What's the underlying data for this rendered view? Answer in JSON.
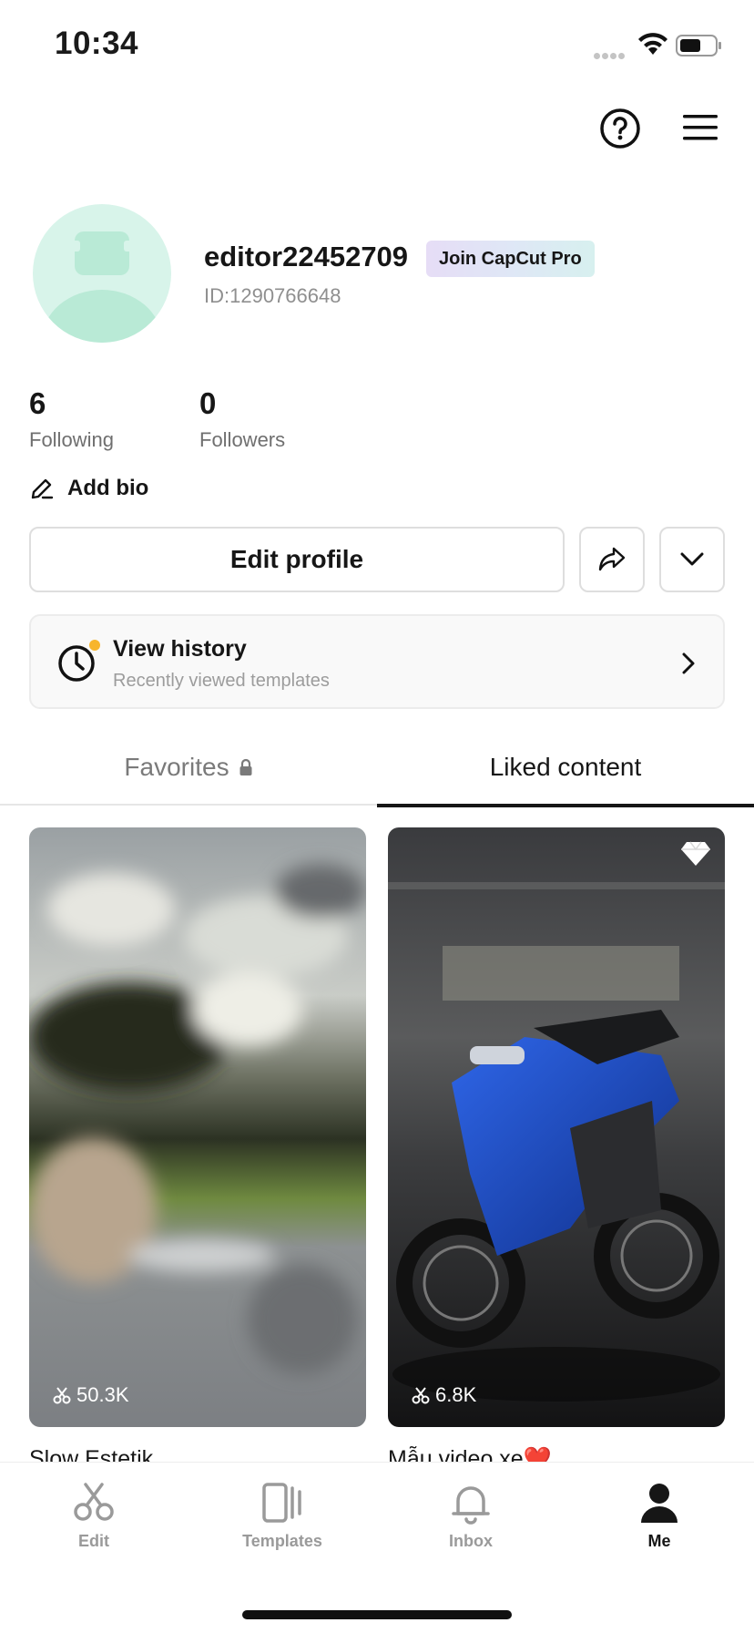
{
  "status_bar": {
    "time": "10:34"
  },
  "profile": {
    "username": "editor22452709",
    "pro_badge": "Join CapCut Pro",
    "id_text": "ID:1290766648",
    "following_count": "6",
    "following_label": "Following",
    "followers_count": "0",
    "followers_label": "Followers",
    "add_bio_label": "Add bio"
  },
  "actions": {
    "edit_profile_label": "Edit profile"
  },
  "history": {
    "title": "View history",
    "subtitle": "Recently viewed templates"
  },
  "tabs": [
    {
      "label": "Favorites",
      "active": false,
      "locked": true
    },
    {
      "label": "Liked content",
      "active": true
    }
  ],
  "cards": [
    {
      "title": "Slow Estetik",
      "uses": "50.3K"
    },
    {
      "title": "Mẫu video xe❤️",
      "uses": "6.8K"
    }
  ],
  "bottom_nav": [
    {
      "label": "Edit",
      "icon": "scissors-icon",
      "active": false
    },
    {
      "label": "Templates",
      "icon": "templates-icon",
      "active": false
    },
    {
      "label": "Inbox",
      "icon": "bell-icon",
      "active": false
    },
    {
      "label": "Me",
      "icon": "person-icon",
      "active": true
    }
  ],
  "colors": {
    "accent": "#161616",
    "badge_dot": "#f7b52c",
    "avatar_bg": "#d8f4ea"
  }
}
